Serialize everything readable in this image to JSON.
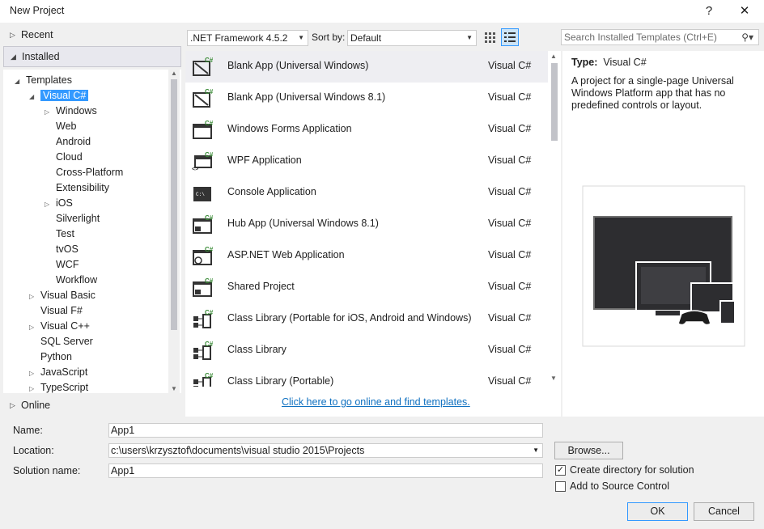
{
  "window": {
    "title": "New Project",
    "help_glyph": "?",
    "close_glyph": "✕"
  },
  "sidebar": {
    "recent": "Recent",
    "installed": "Installed",
    "online": "Online",
    "tree": [
      {
        "label": "Templates"
      },
      {
        "label": "Visual C#"
      },
      {
        "label": "Windows"
      },
      {
        "label": "Web"
      },
      {
        "label": "Android"
      },
      {
        "label": "Cloud"
      },
      {
        "label": "Cross-Platform"
      },
      {
        "label": "Extensibility"
      },
      {
        "label": "iOS"
      },
      {
        "label": "Silverlight"
      },
      {
        "label": "Test"
      },
      {
        "label": "tvOS"
      },
      {
        "label": "WCF"
      },
      {
        "label": "Workflow"
      },
      {
        "label": "Visual Basic"
      },
      {
        "label": "Visual F#"
      },
      {
        "label": "Visual C++"
      },
      {
        "label": "SQL Server"
      },
      {
        "label": "Python"
      },
      {
        "label": "JavaScript"
      },
      {
        "label": "TypeScript"
      }
    ]
  },
  "toolbar": {
    "framework": ".NET Framework 4.5.2",
    "sort_label": "Sort by:",
    "sort_value": "Default",
    "search_placeholder": "Search Installed Templates (Ctrl+E)"
  },
  "templates": [
    {
      "name": "Blank App (Universal Windows)",
      "lang": "Visual C#",
      "icon": "blank-app-icon"
    },
    {
      "name": "Blank App (Universal Windows 8.1)",
      "lang": "Visual C#",
      "icon": "blank-app-icon"
    },
    {
      "name": "Windows Forms Application",
      "lang": "Visual C#",
      "icon": "windows-forms-icon"
    },
    {
      "name": "WPF Application",
      "lang": "Visual C#",
      "icon": "wpf-icon"
    },
    {
      "name": "Console Application",
      "lang": "Visual C#",
      "icon": "console-icon"
    },
    {
      "name": "Hub App (Universal Windows 8.1)",
      "lang": "Visual C#",
      "icon": "hub-app-icon"
    },
    {
      "name": "ASP.NET Web Application",
      "lang": "Visual C#",
      "icon": "aspnet-icon"
    },
    {
      "name": "Shared Project",
      "lang": "Visual C#",
      "icon": "shared-project-icon"
    },
    {
      "name": "Class Library (Portable for iOS, Android and Windows)",
      "lang": "Visual C#",
      "icon": "class-library-icon"
    },
    {
      "name": "Class Library",
      "lang": "Visual C#",
      "icon": "class-library-icon"
    },
    {
      "name": "Class Library (Portable)",
      "lang": "Visual C#",
      "icon": "class-library-icon"
    }
  ],
  "online_link": "Click here to go online and find templates.",
  "details": {
    "type_label": "Type:",
    "type_value": "Visual C#",
    "description": "A project for a single-page Universal Windows Platform app that has no predefined controls or layout."
  },
  "form": {
    "name_label": "Name:",
    "name_value": "App1",
    "location_label": "Location:",
    "location_value": "c:\\users\\krzysztof\\documents\\visual studio 2015\\Projects",
    "solution_label": "Solution name:",
    "solution_value": "App1",
    "browse": "Browse...",
    "create_dir": "Create directory for solution",
    "add_source": "Add to Source Control",
    "ok": "OK",
    "cancel": "Cancel"
  },
  "colors": {
    "selection": "#3399ff",
    "link": "#0e70c0",
    "csharp_badge": "#388a34"
  }
}
